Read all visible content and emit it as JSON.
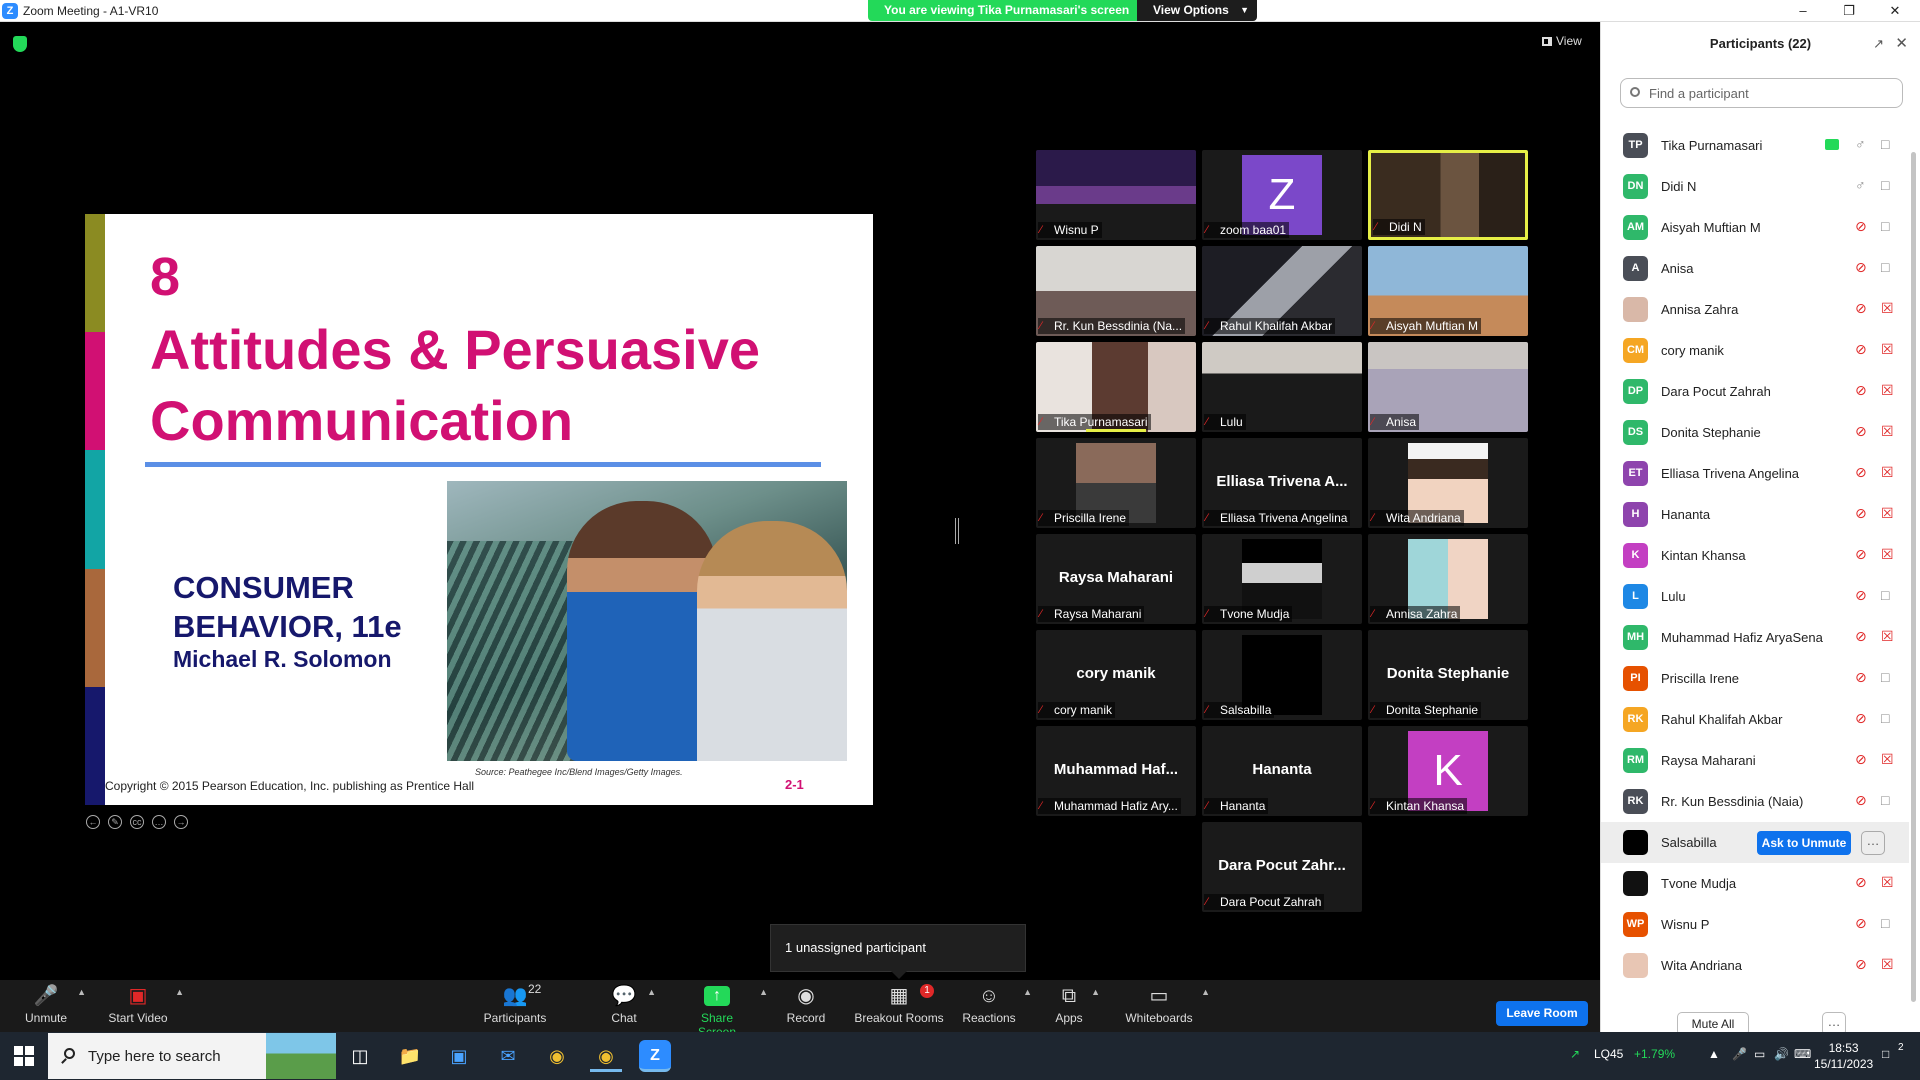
{
  "window": {
    "title": "Zoom Meeting - A1-VR10",
    "logo": "Z",
    "share_banner": "You are viewing Tika Purnamasari's screen",
    "view_options": "View Options",
    "view_label": "View"
  },
  "slide": {
    "number": "8",
    "title": "Attitudes & Persuasive Communication",
    "book_line1": "CONSUMER",
    "book_line2": "BEHAVIOR, 11e",
    "author": "Michael R. Solomon",
    "source": "Source: Peathegee Inc/Blend Images/Getty Images.",
    "copyright": "Copyright © 2015 Pearson Education, Inc. publishing as Prentice Hall",
    "page": "2-1",
    "bar_colors": [
      "#8b8b22",
      "#d11073",
      "#12a5a5",
      "#a9683c",
      "#16186c"
    ]
  },
  "gallery": [
    {
      "name": "Wisnu P",
      "type": "video",
      "bg": "linear-gradient(#2b1a4a 0 40%, #6a3b8a 40% 60%, #1a1a1a 60% 100%)"
    },
    {
      "name": "zoom baa01",
      "type": "letter",
      "letter": "Z",
      "color": "#7b48c9"
    },
    {
      "name": "Didi N",
      "type": "video",
      "active": true,
      "bg": "linear-gradient(90deg, #3a2c1f 0 45%, #6b5440 45% 70%, #2a2018 70%)"
    },
    {
      "name": "Rr. Kun Bessdinia (Na...",
      "type": "video",
      "bg": "linear-gradient(#d8d6d2 0 50%, #6e5b57 50% 100%)"
    },
    {
      "name": "Rahul Khalifah Akbar",
      "type": "video",
      "bg": "linear-gradient(135deg, #1d1d24 0 40%, #9da0a8 40% 60%, #2b2b30 60%)"
    },
    {
      "name": "Aisyah Muftian M",
      "type": "video",
      "bg": "linear-gradient(#8fb7d8 0 55%, #c58a5a 55% 100%)"
    },
    {
      "name": "Tika Purnamasari",
      "type": "video",
      "speaking": true,
      "bg": "linear-gradient(90deg, #e9e3de 0 35%, #5c3b31 35% 70%, #d8c8c0 70%)"
    },
    {
      "name": "Lulu",
      "type": "video",
      "bg": "linear-gradient(#cfcac4 0 35%, #1a1a1a 35% 100%)"
    },
    {
      "name": "Anisa",
      "type": "video",
      "bg": "linear-gradient(#c9c5c2 0 30%, #a9a3b8 30% 100%)"
    },
    {
      "name": "Priscilla Irene",
      "type": "avatar",
      "bg": "linear-gradient(#8a6a5a 0 50%, #3a3a3a 50% 100%)"
    },
    {
      "name": "Elliasa Trivena Angelina",
      "type": "name",
      "bigname": "Elliasa Trivena A..."
    },
    {
      "name": "Wita Andriana",
      "type": "avatar",
      "bg": "linear-gradient(#f3f3f3 0 20%, #3a2a20 20% 45%, #f1d3c0 45% 100%)"
    },
    {
      "name": "Raysa Maharani",
      "type": "name",
      "bigname": "Raysa Maharani"
    },
    {
      "name": "Tvone Mudja",
      "type": "avatar",
      "bg": "linear-gradient(#000 0 30%, #cfcfcf 30% 55%, #111 55% 100%)"
    },
    {
      "name": "Annisa Zahra",
      "type": "avatar",
      "bg": "linear-gradient(90deg, #9fd6d9 0 50%, #f0d4c4 50% 100%)"
    },
    {
      "name": "cory manik",
      "type": "name",
      "bigname": "cory manik"
    },
    {
      "name": "Salsabilla",
      "type": "avatar",
      "bg": "#000"
    },
    {
      "name": "Donita Stephanie",
      "type": "name",
      "bigname": "Donita Stephanie"
    },
    {
      "name": "Muhammad Hafiz Ary...",
      "type": "name",
      "bigname": "Muhammad  Haf..."
    },
    {
      "name": "Hananta",
      "type": "name",
      "bigname": "Hananta"
    },
    {
      "name": "Kintan Khansa",
      "type": "letter",
      "letter": "K",
      "color": "#c33fc2"
    },
    {
      "name": "Dara Pocut Zahrah",
      "type": "name",
      "bigname": "Dara Pocut Zahr..."
    }
  ],
  "unassigned_tooltip": "1 unassigned participant",
  "toolbar": {
    "unmute": "Unmute",
    "start_video": "Start Video",
    "participants": "Participants",
    "participants_count": "22",
    "chat": "Chat",
    "share_screen": "Share Screen",
    "record": "Record",
    "breakout_rooms": "Breakout Rooms",
    "breakout_badge": "1",
    "reactions": "Reactions",
    "apps": "Apps",
    "whiteboards": "Whiteboards",
    "leave_room": "Leave Room"
  },
  "participants_panel": {
    "title": "Participants (22)",
    "search_placeholder": "Find a participant",
    "ask_to_unmute": "Ask to Unmute",
    "mute_all": "Mute All",
    "people": [
      {
        "initials": "TP",
        "name": "Tika Purnamasari",
        "color": "#4a4e57",
        "mic": "on",
        "cam": "on",
        "sharing": true
      },
      {
        "initials": "DN",
        "name": "Didi N",
        "color": "#2fb86a",
        "mic": "on",
        "cam": "on"
      },
      {
        "initials": "AM",
        "name": "Aisyah Muftian M",
        "color": "#2fb86a",
        "mic": "off",
        "cam": "on"
      },
      {
        "initials": "A",
        "name": "Anisa",
        "color": "#4a4e57",
        "mic": "off",
        "cam": "on"
      },
      {
        "initials": "",
        "name": "Annisa Zahra",
        "color": "#d9b8a8",
        "mic": "off",
        "cam": "off",
        "photo": true
      },
      {
        "initials": "CM",
        "name": "cory manik",
        "color": "#f5a623",
        "mic": "off",
        "cam": "off"
      },
      {
        "initials": "DP",
        "name": "Dara Pocut Zahrah",
        "color": "#2fb86a",
        "mic": "off",
        "cam": "off"
      },
      {
        "initials": "DS",
        "name": "Donita Stephanie",
        "color": "#2fb86a",
        "mic": "off",
        "cam": "off"
      },
      {
        "initials": "ET",
        "name": "Elliasa Trivena Angelina",
        "color": "#8e44ad",
        "mic": "off",
        "cam": "off"
      },
      {
        "initials": "H",
        "name": "Hananta",
        "color": "#8e44ad",
        "mic": "off",
        "cam": "off"
      },
      {
        "initials": "K",
        "name": "Kintan Khansa",
        "color": "#c33fc2",
        "mic": "off",
        "cam": "off"
      },
      {
        "initials": "L",
        "name": "Lulu",
        "color": "#1e88e5",
        "mic": "off",
        "cam": "on"
      },
      {
        "initials": "MH",
        "name": "Muhammad Hafiz AryaSena",
        "color": "#2fb86a",
        "mic": "off",
        "cam": "off"
      },
      {
        "initials": "PI",
        "name": "Priscilla Irene",
        "color": "#e65100",
        "mic": "off",
        "cam": "on"
      },
      {
        "initials": "RK",
        "name": "Rahul Khalifah Akbar",
        "color": "#f5a623",
        "mic": "off",
        "cam": "on"
      },
      {
        "initials": "RM",
        "name": "Raysa Maharani",
        "color": "#2fb86a",
        "mic": "off",
        "cam": "off"
      },
      {
        "initials": "RK",
        "name": "Rr. Kun Bessdinia (Naia)",
        "color": "#4a4e57",
        "mic": "off",
        "cam": "on"
      },
      {
        "initials": "",
        "name": "Salsabilla",
        "color": "#000000",
        "highlight": true
      },
      {
        "initials": "",
        "name": "Tvone Mudja",
        "color": "#111111",
        "mic": "off",
        "cam": "off",
        "photo": true
      },
      {
        "initials": "WP",
        "name": "Wisnu P",
        "color": "#e65100",
        "mic": "off",
        "cam": "on"
      },
      {
        "initials": "",
        "name": "Wita Andriana",
        "color": "#e8c6b4",
        "mic": "off",
        "cam": "off",
        "photo": true
      }
    ]
  },
  "taskbar": {
    "search_placeholder": "Type here to search",
    "stock": "LQ45",
    "stock_change": "+1.79%",
    "time": "18:53",
    "date": "15/11/2023",
    "notification_count": "2"
  }
}
